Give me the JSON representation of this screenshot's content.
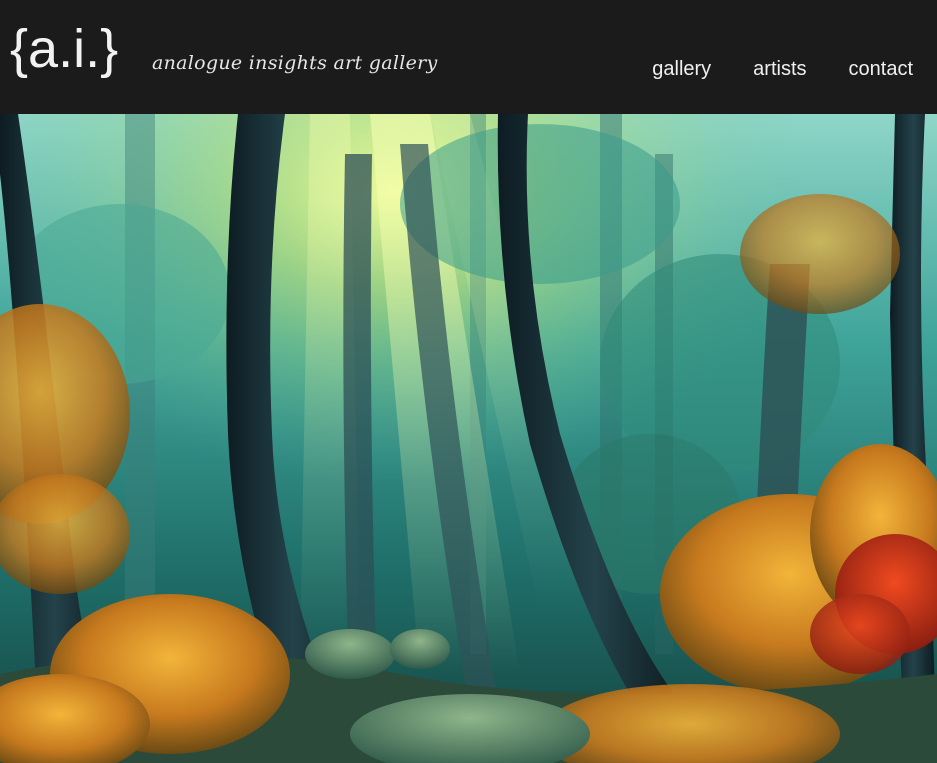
{
  "header": {
    "logo": "{a.i.}",
    "tagline": "analogue insights art gallery",
    "background": "#1b1b1b"
  },
  "nav": {
    "items": [
      {
        "label": "gallery"
      },
      {
        "label": "artists"
      },
      {
        "label": "contact"
      }
    ]
  },
  "hero": {
    "image": "forest-painting"
  }
}
